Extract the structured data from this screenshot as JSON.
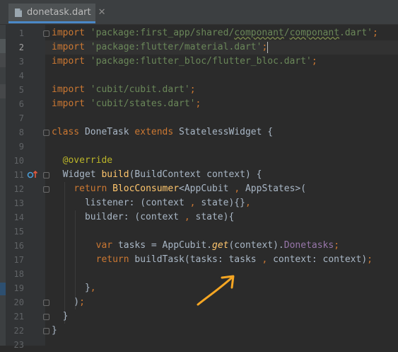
{
  "tab": {
    "title": "donetask.dart",
    "close": "✕"
  },
  "editor": {
    "current_line": 2,
    "lines": [
      {
        "n": "1",
        "segs": [
          [
            "kw",
            "import "
          ],
          [
            "str",
            "'package:first_app/shared/"
          ],
          [
            "strul",
            "componant"
          ],
          [
            "str",
            "/"
          ],
          [
            "strul",
            "componant"
          ],
          [
            "str",
            ".dart'"
          ],
          [
            "kw",
            ";"
          ]
        ]
      },
      {
        "n": "2",
        "segs": [
          [
            "kw",
            "import "
          ],
          [
            "str",
            "'package:flutter/material.dart'"
          ],
          [
            "kw",
            ";"
          ]
        ]
      },
      {
        "n": "3",
        "segs": [
          [
            "kw",
            "import "
          ],
          [
            "str",
            "'package:flutter_bloc/flutter_bloc.dart'"
          ],
          [
            "kw",
            ";"
          ]
        ]
      },
      {
        "n": "4",
        "segs": []
      },
      {
        "n": "5",
        "segs": [
          [
            "kw",
            "import "
          ],
          [
            "str",
            "'cubit/cubit.dart'"
          ],
          [
            "kw",
            ";"
          ]
        ]
      },
      {
        "n": "6",
        "segs": [
          [
            "kw",
            "import "
          ],
          [
            "str",
            "'cubit/states.dart'"
          ],
          [
            "kw",
            ";"
          ]
        ]
      },
      {
        "n": "7",
        "segs": []
      },
      {
        "n": "8",
        "segs": [
          [
            "kw",
            "class "
          ],
          [
            "cls",
            "DoneTask "
          ],
          [
            "kw",
            "extends "
          ],
          [
            "cls",
            "StatelessWidget {"
          ]
        ]
      },
      {
        "n": "9",
        "segs": []
      },
      {
        "n": "10",
        "segs": [
          [
            "cls",
            "  "
          ],
          [
            "ann",
            "@override"
          ]
        ]
      },
      {
        "n": "11",
        "segs": [
          [
            "cls",
            "  Widget "
          ],
          [
            "typ",
            "build"
          ],
          [
            "cls",
            "(BuildContext context) {"
          ]
        ]
      },
      {
        "n": "12",
        "segs": [
          [
            "cls",
            "    "
          ],
          [
            "kw",
            "return "
          ],
          [
            "typ",
            "BlocConsumer"
          ],
          [
            "cls",
            "<AppCubit "
          ],
          [
            "kw",
            ", "
          ],
          [
            "cls",
            "AppStates>("
          ]
        ]
      },
      {
        "n": "13",
        "segs": [
          [
            "cls",
            "      listener: (context "
          ],
          [
            "kw",
            ", "
          ],
          [
            "cls",
            "state){}"
          ],
          [
            "kw",
            ","
          ]
        ]
      },
      {
        "n": "14",
        "segs": [
          [
            "cls",
            "      builder: (context "
          ],
          [
            "kw",
            ", "
          ],
          [
            "cls",
            "state){"
          ]
        ]
      },
      {
        "n": "15",
        "segs": []
      },
      {
        "n": "16",
        "segs": [
          [
            "cls",
            "        "
          ],
          [
            "kw",
            "var "
          ],
          [
            "cls",
            "tasks = AppCubit."
          ],
          [
            "fnit",
            "get"
          ],
          [
            "cls",
            "(context)."
          ],
          [
            "prop",
            "Donetasks"
          ],
          [
            "kw",
            ";"
          ]
        ]
      },
      {
        "n": "17",
        "segs": [
          [
            "cls",
            "        "
          ],
          [
            "kw",
            "return "
          ],
          [
            "cls",
            "buildTask(tasks: tasks "
          ],
          [
            "kw",
            ", "
          ],
          [
            "cls",
            "context: context)"
          ],
          [
            "kw",
            ";"
          ]
        ]
      },
      {
        "n": "18",
        "segs": []
      },
      {
        "n": "19",
        "segs": [
          [
            "cls",
            "      }"
          ],
          [
            "kw",
            ","
          ]
        ]
      },
      {
        "n": "20",
        "segs": [
          [
            "cls",
            "    )"
          ],
          [
            "kw",
            ";"
          ]
        ]
      },
      {
        "n": "21",
        "segs": [
          [
            "cls",
            "  }"
          ]
        ]
      },
      {
        "n": "22",
        "segs": [
          [
            "cls",
            "}"
          ]
        ]
      },
      {
        "n": "23",
        "segs": []
      }
    ]
  },
  "colors": {
    "background": "#2b2b2b",
    "arrow": "#f5a623",
    "keyword": "#cc7832",
    "string": "#6a8759"
  },
  "icons": {
    "file": "dart-file-icon",
    "override": "override-method-icon",
    "annotation": "hand-drawn-arrow"
  }
}
